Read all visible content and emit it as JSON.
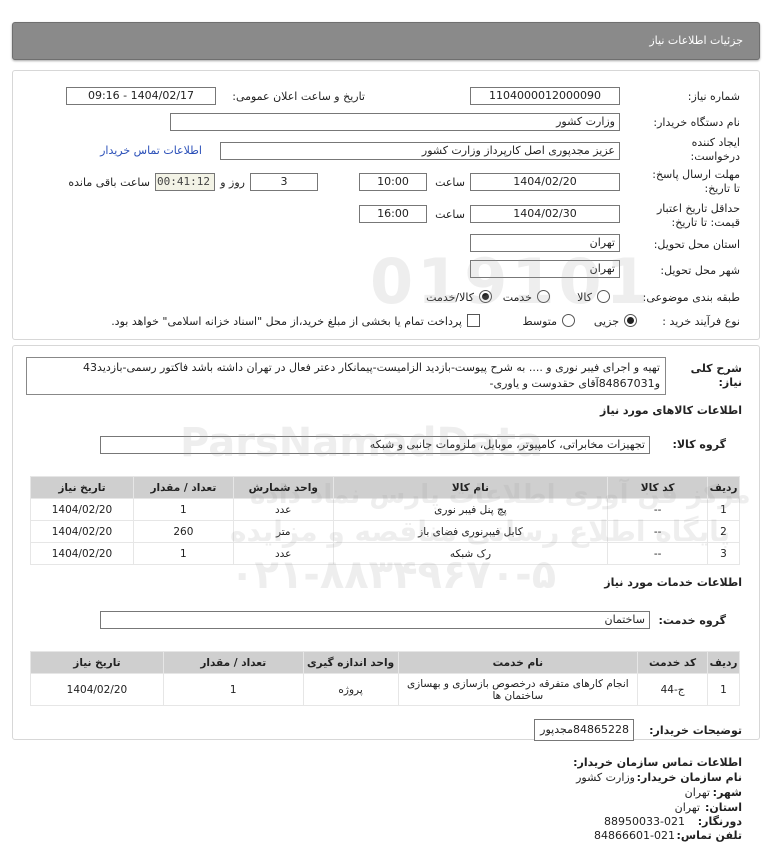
{
  "header": {
    "title": "جزئیات اطلاعات نیاز"
  },
  "info": {
    "need_number_label": "شماره نیاز:",
    "need_number": "1104000012000090",
    "announce_label": "تاریخ و ساعت اعلان عمومی:",
    "announce_value": "1404/02/17 - 09:16",
    "buyer_org_label": "نام دستگاه خریدار:",
    "buyer_org": "وزارت کشور",
    "creator_label_1": "ایجاد کننده",
    "creator_label_2": "درخواست:",
    "creator": "عزیز مجدپوری اصل کارپرداز وزارت کشور",
    "contact_link": "اطلاعات تماس خریدار",
    "reply_deadline_label_1": "مهلت ارسال پاسخ:",
    "reply_deadline_label_2": "تا تاریخ:",
    "reply_date": "1404/02/20",
    "time_label": "ساعت",
    "reply_time": "10:00",
    "days": "3",
    "days_label": "روز و",
    "remaining": "00:41:12",
    "remaining_label": "ساعت باقی مانده",
    "validity_label_1": "حداقل تاریخ اعتبار",
    "validity_label_2": "قیمت: تا تاریخ:",
    "validity_date": "1404/02/30",
    "validity_time": "16:00",
    "province_label": "استان محل تحویل:",
    "province": "تهران",
    "city_label": "شهر محل تحویل:",
    "city": "تهران",
    "category_label": "طبقه بندی موضوعی:",
    "cat_goods": "کالا",
    "cat_service": "خدمت",
    "cat_both": "کالا/خدمت",
    "process_label": "نوع فرآیند خرید :",
    "proc_partial": "جزیی",
    "proc_medium": "متوسط",
    "payment_note": "پرداخت تمام یا بخشی از مبلغ خرید،از محل \"اسناد خزانه اسلامی\" خواهد بود."
  },
  "description": {
    "label_1": "شرح کلی",
    "label_2": "نیاز:",
    "text": "تهیه و اجرای فیبر نوری و .... به شرح پیوست-بازدید الزامیست-پیمانکار دعتر فعال در تهران داشته باشد فاکتور رسمی-بازدید43 و84867031آقای حقدوست و یاوری-"
  },
  "goods": {
    "section_title": "اطلاعات کالاهای مورد نیاز",
    "group_label": "گروه کالا:",
    "group": "تجهیزات مخابراتی، کامپیوتر، موبایل، ملزومات جانبی و شبکه",
    "headers": [
      "ردیف",
      "کد کالا",
      "نام کالا",
      "واحد شمارش",
      "تعداد / مقدار",
      "تاریخ نیاز"
    ],
    "rows": [
      {
        "row": "1",
        "code": "--",
        "name": "پچ پنل فیبر نوری",
        "unit": "عدد",
        "qty": "1",
        "date": "1404/02/20"
      },
      {
        "row": "2",
        "code": "--",
        "name": "کابل فیبرنوری فضای باز",
        "unit": "متر",
        "qty": "260",
        "date": "1404/02/20"
      },
      {
        "row": "3",
        "code": "--",
        "name": "رک شبکه",
        "unit": "عدد",
        "qty": "1",
        "date": "1404/02/20"
      }
    ]
  },
  "services": {
    "section_title": "اطلاعات خدمات مورد نیاز",
    "group_label": "گروه خدمت:",
    "group": "ساختمان",
    "headers": [
      "ردیف",
      "کد خدمت",
      "نام خدمت",
      "واحد اندازه گیری",
      "تعداد / مقدار",
      "تاریخ نیاز"
    ],
    "rows": [
      {
        "row": "1",
        "code": "ج-44",
        "name": "انجام کارهای متفرقه درخصوص بازسازی و بهسازی ساختمان ها",
        "unit": "پروژه",
        "qty": "1",
        "date": "1404/02/20"
      }
    ]
  },
  "buyer_notes": {
    "label": "توضیحات خریدار:",
    "text": "84865228مجدپور"
  },
  "contact": {
    "title": "اطلاعات تماس سازمان خریدار:",
    "org_label": "نام سازمان خریدار:",
    "org": "وزارت کشور",
    "city_label": "شهر:",
    "city": "تهران",
    "province_label": "استان:",
    "province": "تهران",
    "fax_label": "دورنگار:",
    "fax": "88950033-021",
    "phone_label": "تلفن تماس:",
    "phone": "84866601-021"
  },
  "watermark": {
    "brand": "ParsNamadData",
    "numbers": "019101",
    "line1": "مرکز فن آوری اطلاعات پارس نماد داده",
    "line2": "پایگاه اطلاع رسانی مناقصه و مزایده",
    "phone": "۰۲۱-۸۸۳۴۹۶۷۰-۵"
  }
}
